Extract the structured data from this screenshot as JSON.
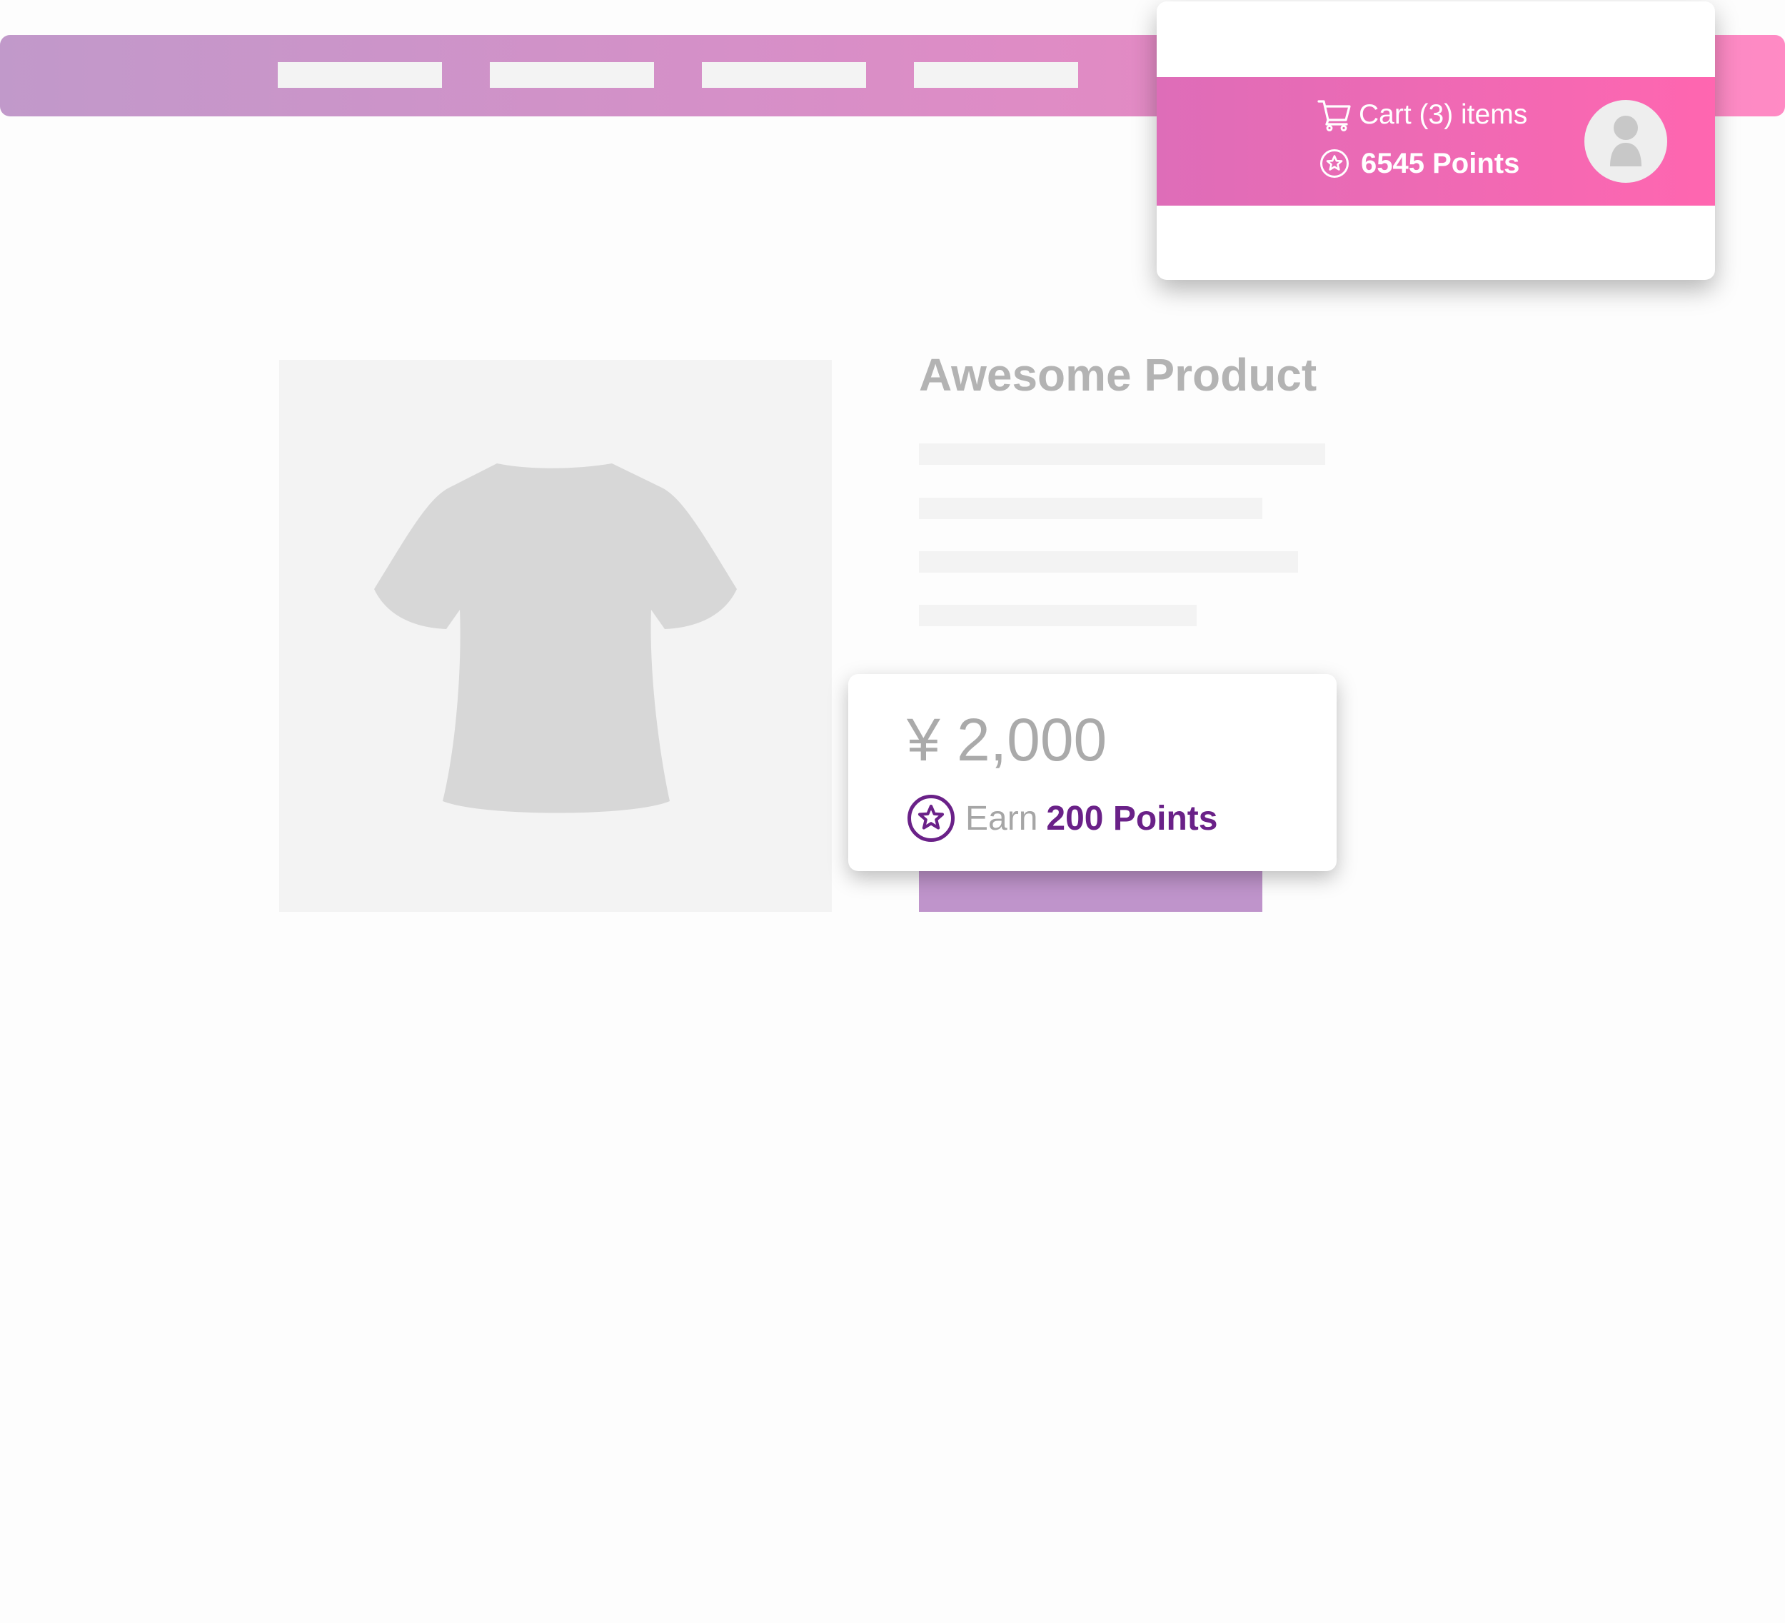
{
  "navbar": {
    "items": [
      {
        "label": ""
      },
      {
        "label": ""
      },
      {
        "label": ""
      },
      {
        "label": ""
      }
    ]
  },
  "account": {
    "cart_label": "Cart (3) items",
    "points_label": "6545 Points",
    "icons": {
      "cart": "shopping-cart-icon",
      "points": "star-badge-icon",
      "avatar": "user-avatar-icon"
    }
  },
  "product": {
    "title": "Awesome Product",
    "image_icon": "t-shirt-icon",
    "description_lines": [
      "",
      "",
      "",
      ""
    ],
    "add_to_cart_label": ""
  },
  "price_card": {
    "price": "¥ 2,000",
    "earn_label": "Earn",
    "earn_points": "200 Points",
    "icon": "star-badge-icon"
  },
  "colors": {
    "brand_purple": "#6a2188",
    "navbar_start": "#c199ca",
    "navbar_end": "#ff8ac4",
    "account_band_start": "#de6db8",
    "account_band_end": "#ff66b0",
    "button": "#bf94cb",
    "placeholder": "#f3f3f3"
  }
}
